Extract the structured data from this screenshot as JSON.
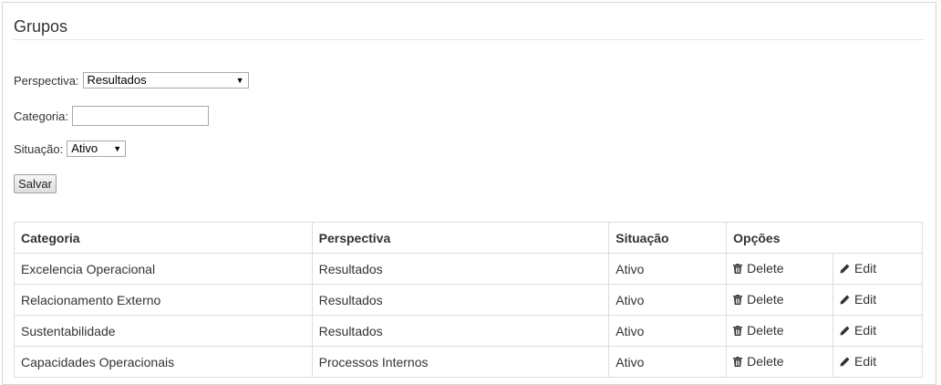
{
  "page": {
    "title": "Grupos"
  },
  "form": {
    "perspectiva_label": "Perspectiva:",
    "perspectiva_value": "Resultados",
    "categoria_label": "Categoria:",
    "categoria_value": "",
    "situacao_label": "Situação:",
    "situacao_value": "Ativo",
    "save_label": "Salvar"
  },
  "table": {
    "headers": [
      "Categoria",
      "Perspectiva",
      "Situação",
      "Opções"
    ],
    "delete_label": "Delete",
    "edit_label": "Edit",
    "rows": [
      {
        "categoria": "Excelencia Operacional",
        "perspectiva": "Resultados",
        "situacao": "Ativo"
      },
      {
        "categoria": "Relacionamento Externo",
        "perspectiva": "Resultados",
        "situacao": "Ativo"
      },
      {
        "categoria": "Sustentabilidade",
        "perspectiva": "Resultados",
        "situacao": "Ativo"
      },
      {
        "categoria": "Capacidades Operacionais",
        "perspectiva": "Processos Internos",
        "situacao": "Ativo"
      }
    ]
  },
  "icons": {
    "delete": "trash-icon",
    "edit": "pencil-icon",
    "dropdown": "chevron-down-icon"
  }
}
